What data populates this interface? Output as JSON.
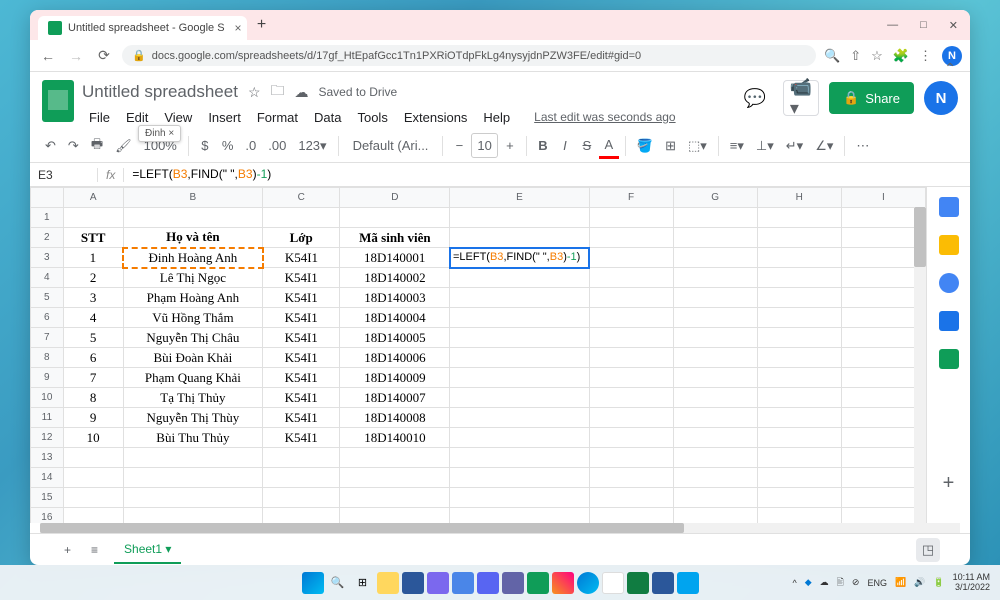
{
  "browser": {
    "tab_title": "Untitled spreadsheet - Google S",
    "url": "docs.google.com/spreadsheets/d/17gf_HtEpafGcc1Tn1PXRiOTdpFkLg4nysyjdnPZW3FE/edit#gid=0",
    "avatar_letter": "N"
  },
  "doc": {
    "title": "Untitled spreadsheet",
    "saved": "Saved to Drive",
    "last_edit": "Last edit was seconds ago",
    "share": "Share"
  },
  "menu": [
    "File",
    "Edit",
    "View",
    "Insert",
    "Format",
    "Data",
    "Tools",
    "Extensions",
    "Help"
  ],
  "toolbar": {
    "zoom": "100%",
    "font": "Default (Ari...",
    "size": "10",
    "hint": "Đinh ×"
  },
  "formula": {
    "cell": "E3",
    "text": "=LEFT(B3,FIND(\" \",B3)-1)",
    "parts": {
      "p1": "=LEFT(",
      "r1": "B3",
      "p2": ",FIND(\" \",",
      "r2": "B3",
      "p3": ")",
      "n1": "-1",
      "p4": ")"
    }
  },
  "columns": [
    "A",
    "B",
    "C",
    "D",
    "E",
    "F",
    "G",
    "H",
    "I"
  ],
  "header_row": {
    "a": "STT",
    "b": "Họ và tên",
    "c": "Lớp",
    "d": "Mã sinh viên"
  },
  "rows": [
    {
      "stt": "1",
      "name": "Đinh Hoàng Anh",
      "class": "K54I1",
      "id": "18D140001"
    },
    {
      "stt": "2",
      "name": "Lê Thị Ngọc",
      "class": "K54I1",
      "id": "18D140002"
    },
    {
      "stt": "3",
      "name": "Phạm Hoàng Anh",
      "class": "K54I1",
      "id": "18D140003"
    },
    {
      "stt": "4",
      "name": "Vũ Hồng Thắm",
      "class": "K54I1",
      "id": "18D140004"
    },
    {
      "stt": "5",
      "name": "Nguyễn Thị Châu",
      "class": "K54I1",
      "id": "18D140005"
    },
    {
      "stt": "6",
      "name": "Bùi Đoàn Khải",
      "class": "K54I1",
      "id": "18D140006"
    },
    {
      "stt": "7",
      "name": "Phạm Quang Khải",
      "class": "K54I1",
      "id": "18D140009"
    },
    {
      "stt": "8",
      "name": "Tạ Thị Thủy",
      "class": "K54I1",
      "id": "18D140007"
    },
    {
      "stt": "9",
      "name": "Nguyễn Thị Thùy",
      "class": "K54I1",
      "id": "18D140008"
    },
    {
      "stt": "10",
      "name": "Bùi Thu Thủy",
      "class": "K54I1",
      "id": "18D140010"
    }
  ],
  "sheet_tab": "Sheet1",
  "taskbar": {
    "lang": "ENG",
    "time": "10:11 AM",
    "date": "3/1/2022"
  }
}
